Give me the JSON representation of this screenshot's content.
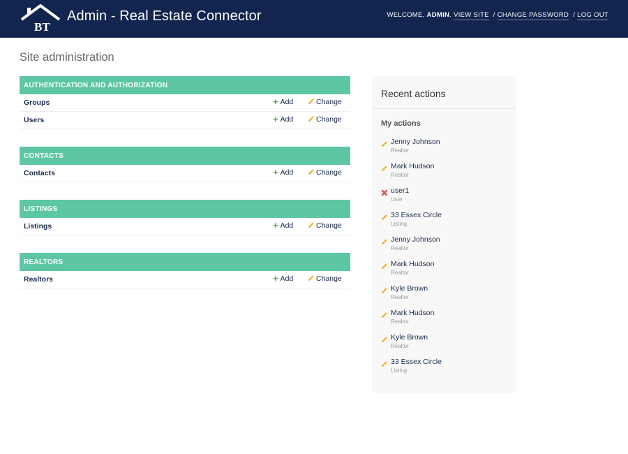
{
  "header": {
    "logo_text": "BT",
    "brand": "Admin - Real Estate Connector",
    "welcome": "WELCOME, ",
    "username": "ADMIN",
    "welcome_suffix": ".",
    "view_site": "VIEW SITE",
    "change_password": "CHANGE PASSWORD",
    "log_out": "LOG OUT",
    "separator": "/"
  },
  "page_title": "Site administration",
  "colors": {
    "header_bg": "#12254f",
    "module_caption_bg": "#5dc7a4",
    "add_icon": "#5aa63f",
    "change_icon": "#f0b429",
    "delete_icon": "#d9534f"
  },
  "modules": [
    {
      "caption": "AUTHENTICATION AND AUTHORIZATION",
      "rows": [
        {
          "name": "Groups",
          "add": "Add",
          "change": "Change"
        },
        {
          "name": "Users",
          "add": "Add",
          "change": "Change"
        }
      ]
    },
    {
      "caption": "CONTACTS",
      "rows": [
        {
          "name": "Contacts",
          "add": "Add",
          "change": "Change"
        }
      ]
    },
    {
      "caption": "LISTINGS",
      "rows": [
        {
          "name": "Listings",
          "add": "Add",
          "change": "Change"
        }
      ]
    },
    {
      "caption": "REALTORS",
      "rows": [
        {
          "name": "Realtors",
          "add": "Add",
          "change": "Change"
        }
      ]
    }
  ],
  "recent_actions": {
    "title": "Recent actions",
    "subtitle": "My actions",
    "items": [
      {
        "icon": "pencil-icon",
        "text": "Jenny Johnson",
        "type": "Realtor"
      },
      {
        "icon": "pencil-icon",
        "text": "Mark Hudson",
        "type": "Realtor"
      },
      {
        "icon": "delete-icon",
        "text": "user1",
        "type": "User"
      },
      {
        "icon": "pencil-icon",
        "text": "33 Essex Circle",
        "type": "Listing"
      },
      {
        "icon": "pencil-icon",
        "text": "Jenny Johnson",
        "type": "Realtor"
      },
      {
        "icon": "pencil-icon",
        "text": "Mark Hudson",
        "type": "Realtor"
      },
      {
        "icon": "pencil-icon",
        "text": "Kyle Brown",
        "type": "Realtor"
      },
      {
        "icon": "pencil-icon",
        "text": "Mark Hudson",
        "type": "Realtor"
      },
      {
        "icon": "pencil-icon",
        "text": "Kyle Brown",
        "type": "Realtor"
      },
      {
        "icon": "pencil-icon",
        "text": "33 Essex Circle",
        "type": "Listing"
      }
    ]
  }
}
